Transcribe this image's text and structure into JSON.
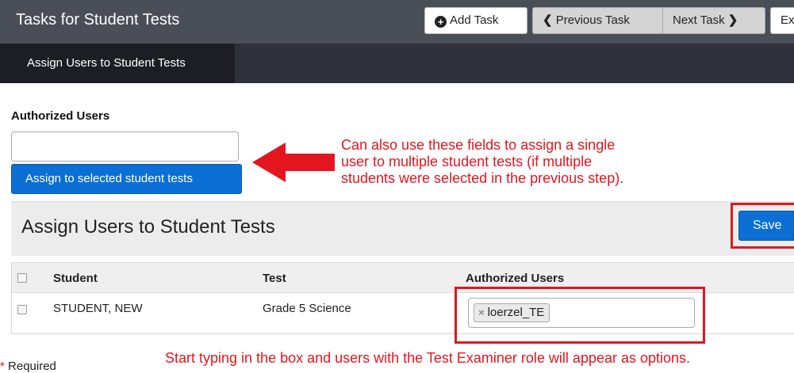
{
  "header": {
    "title": "Tasks for Student Tests",
    "add_task_label": "Add Task",
    "previous_task_label": "Previous Task",
    "next_task_label": "Next Task",
    "exit_label": "Exit",
    "add_icon": "plus-circle-icon",
    "prev_icon": "chevron-left-icon",
    "next_icon": "chevron-right-icon"
  },
  "subnav": {
    "active_tab": "Assign Users to Student Tests"
  },
  "form": {
    "authorized_users_label": "Authorized Users",
    "authorized_users_value": "",
    "assign_button_label": "Assign to selected student tests"
  },
  "annotations": {
    "arrow_note": "Can also use these fields to assign a single user to multiple student tests (if multiple students were selected in the previous step).",
    "arrow_note_lines": [
      "Can also use these fields to assign a single",
      "user to multiple student tests (if multiple",
      "students were selected in the previous step)."
    ],
    "bottom_note": "Start typing in the box and users with the Test Examiner role will appear as options."
  },
  "panel": {
    "title": "Assign Users to Student Tests",
    "save_label": "Save"
  },
  "table": {
    "headers": [
      "Student",
      "Test",
      "Authorized Users"
    ],
    "rows": [
      {
        "student": "STUDENT, NEW",
        "test": "Grade 5 Science",
        "authorized_users": [
          "loerzel_TE"
        ]
      }
    ]
  },
  "footer": {
    "required_marker": "*",
    "required_label": "Required"
  },
  "colors": {
    "header": "#4a4e57",
    "subnav": "#2e3139",
    "primary": "#0b6fd6",
    "annotation": "#e3161f"
  }
}
